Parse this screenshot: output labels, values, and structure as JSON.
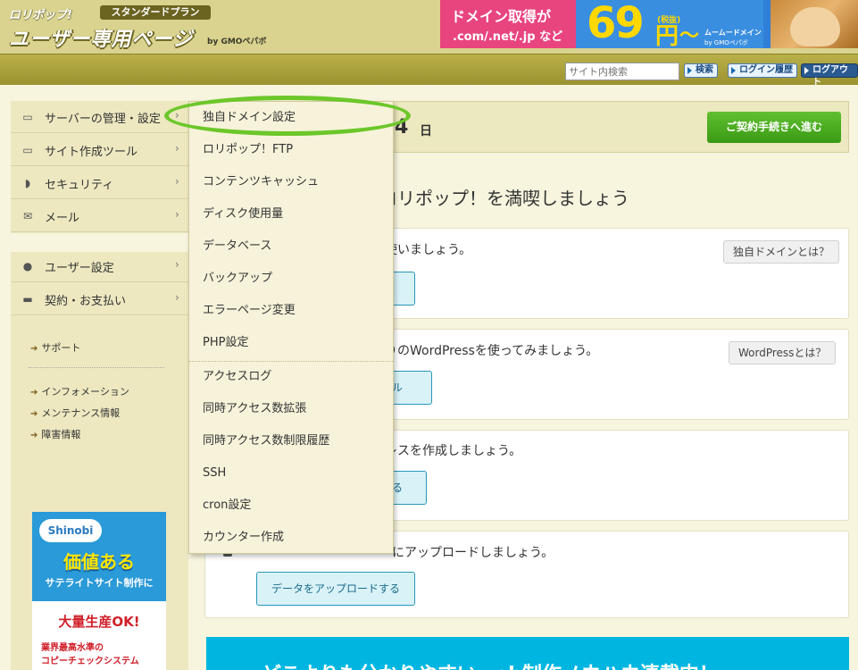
{
  "header": {
    "brand": "ロリポップ!",
    "plan": "スタンダードプラン",
    "title": "ユーザー専用ページ",
    "by": "by GMOペパボ"
  },
  "ad": {
    "line1": "ドメイン取得が",
    "line2": ".com/.net/.jp など",
    "price": "69",
    "tax": "(税抜)",
    "yen": "円",
    "tilde": "〜",
    "muumuu": "ムームードメイン",
    "gmo": "by GMOペパボ"
  },
  "navbar": {
    "search_placeholder": "サイト内検索",
    "search_button": "検索",
    "login_history": "ログイン履歴",
    "logout": "ログアウト"
  },
  "sidebar": {
    "items": [
      {
        "label": "サーバーの管理・設定",
        "icon": "server-icon"
      },
      {
        "label": "サイト作成ツール",
        "icon": "laptop-icon"
      },
      {
        "label": "セキュリティ",
        "icon": "shield-icon"
      },
      {
        "label": "メール",
        "icon": "mail-icon"
      },
      {
        "label": "ユーザー設定",
        "icon": "user-icon"
      },
      {
        "label": "契約・お支払い",
        "icon": "credit-card-icon"
      }
    ],
    "links": [
      "サポート",
      "インフォメーション",
      "メンテナンス情報",
      "障害情報"
    ]
  },
  "shinobi": {
    "logo": "Shinobi",
    "headline": "価値ある",
    "subline": "サテライトサイト制作に",
    "ok": "大量生産OK!",
    "line3": "業界最高水準の",
    "line4": "コピーチェックシステム"
  },
  "main": {
    "trial_number": "4",
    "trial_unit": "日",
    "contract_button": "ご契約手続きへ進む",
    "heading": "ロリポップ！を満喫しましょう",
    "cards": [
      {
        "text": "使いましょう。",
        "help": "独自ドメインとは？",
        "button": "る"
      },
      {
        "text": "りのWordPressを使ってみましょう。",
        "help": "WordPressとは？",
        "button": "ール"
      },
      {
        "text": "レスを作成しましょう。",
        "button": "する"
      },
      {
        "text": "にアップロードしましょう。",
        "button": "データをアップロードする"
      }
    ],
    "banner": "どこよりも分かりやすいweb制作ノウハウ連載中！"
  },
  "dropdown": {
    "items": [
      "独自ドメイン設定",
      "ロリポップ！FTP",
      "コンテンツキャッシュ",
      "ディスク使用量",
      "データベース",
      "バックアップ",
      "エラーページ変更",
      "PHP設定",
      "アクセスログ",
      "同時アクセス数拡張",
      "同時アクセス数制限履歴",
      "SSH",
      "cron設定",
      "カウンター作成"
    ]
  },
  "colors": {
    "highlight_ring": "#6cc72a",
    "contract_button": "#3a9a14",
    "banner": "#00b6e0"
  }
}
